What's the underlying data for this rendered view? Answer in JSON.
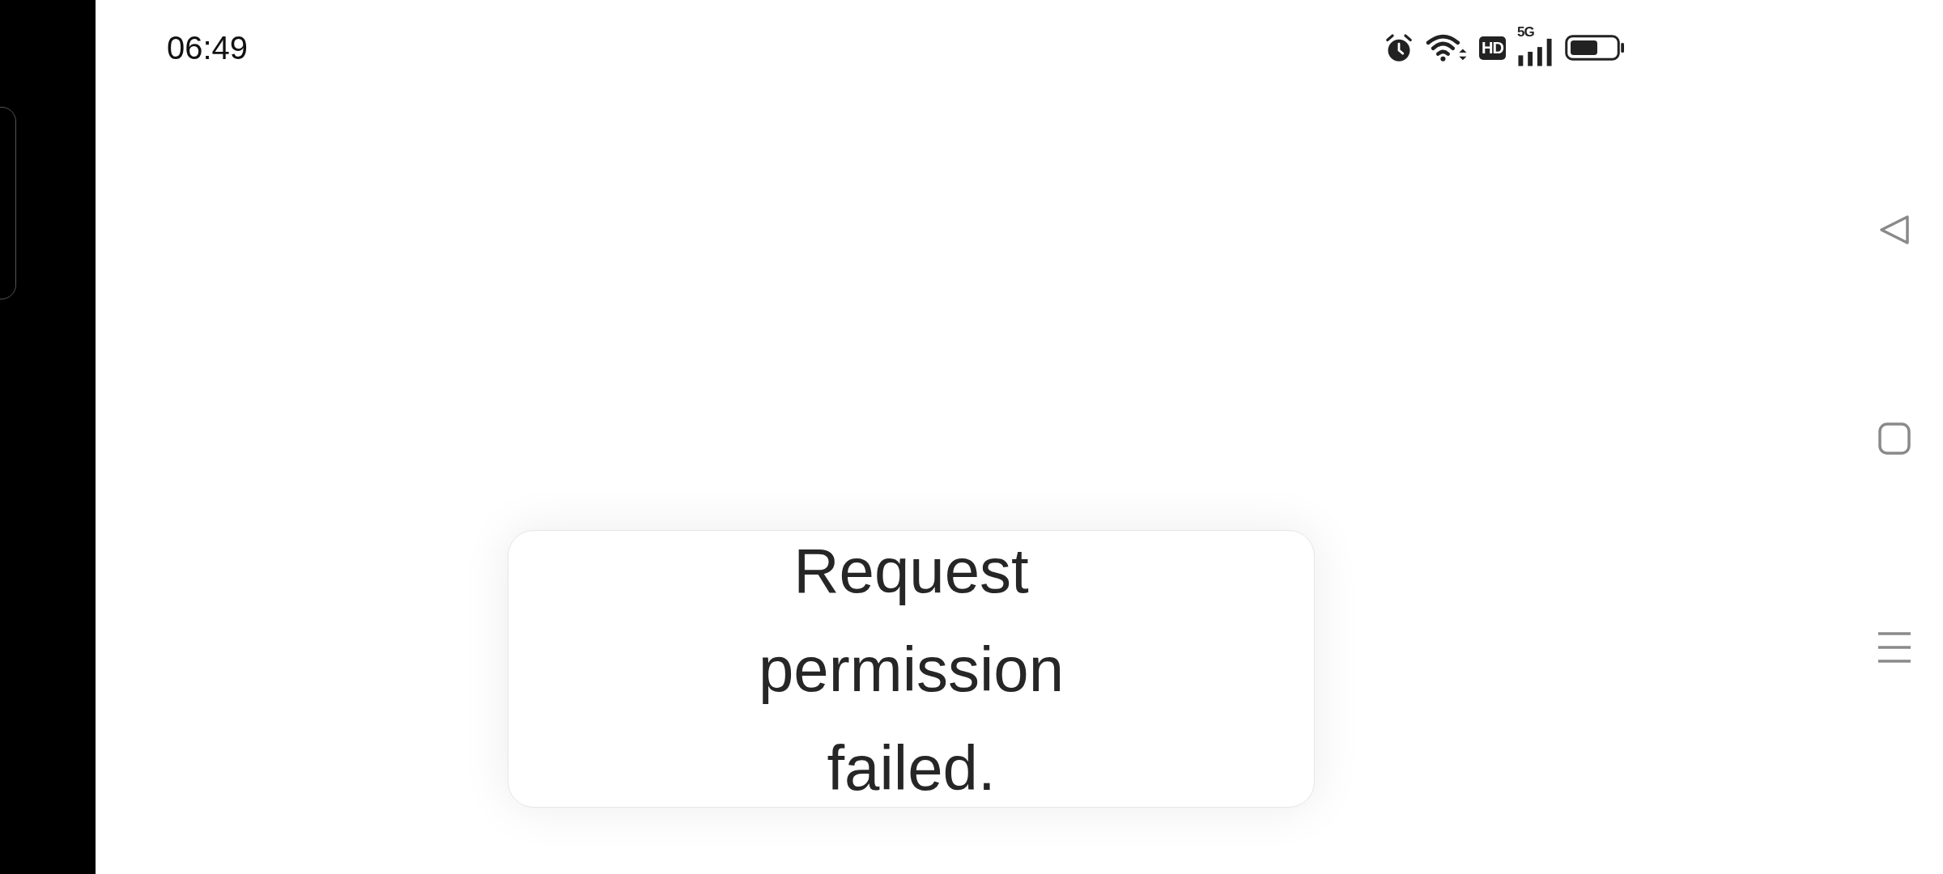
{
  "status_bar": {
    "time": "06:49",
    "hd_badge": "HD",
    "network": "5G"
  },
  "toast": {
    "message": "Request permission failed."
  }
}
